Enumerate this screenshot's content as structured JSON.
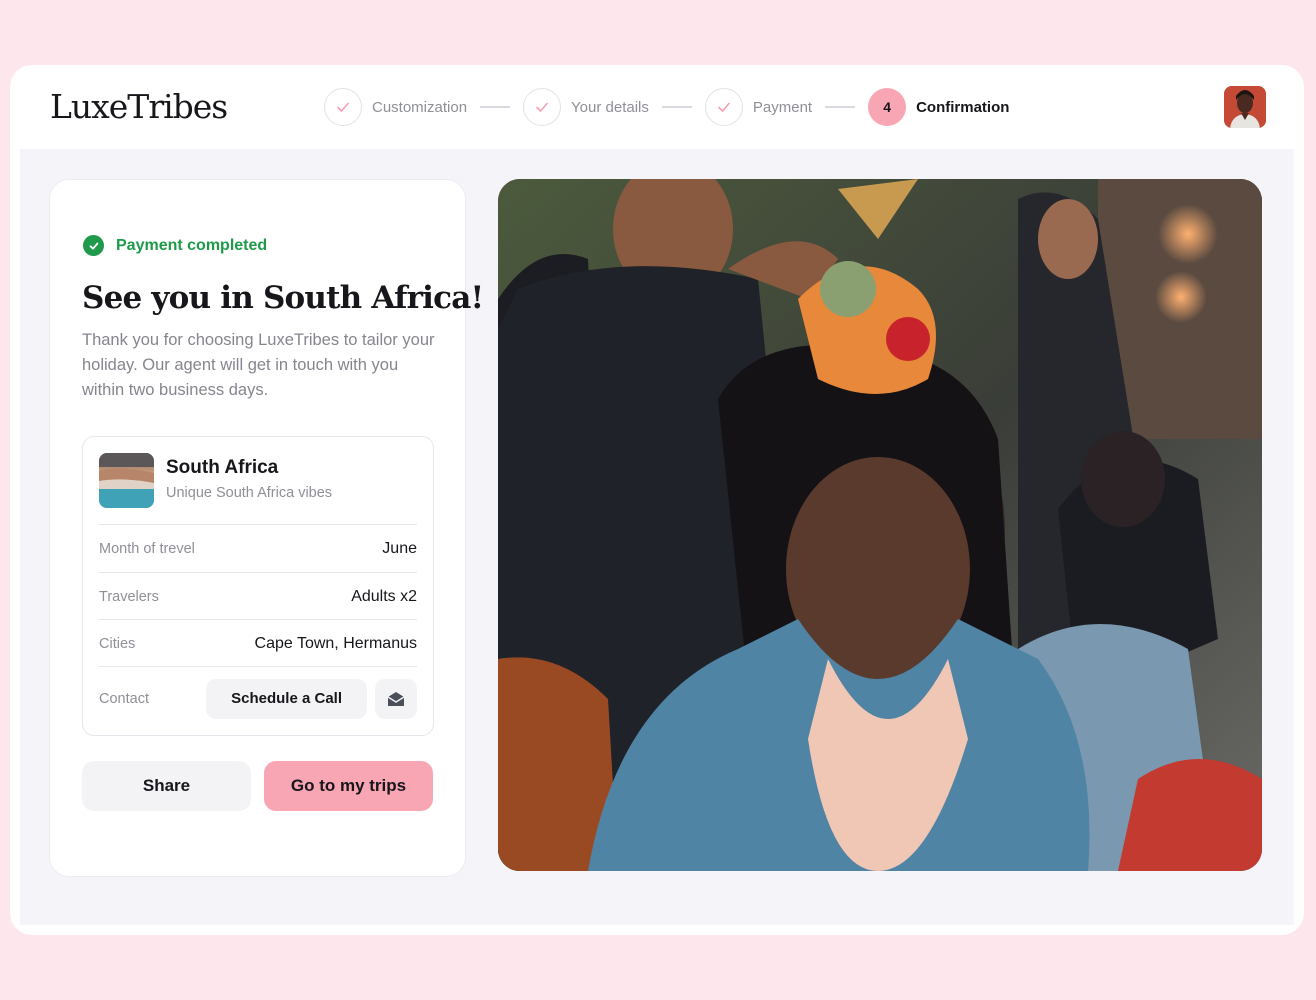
{
  "brand": {
    "name": "LuxeTribes"
  },
  "stepper": {
    "steps": [
      {
        "label": "Customization",
        "state": "done"
      },
      {
        "label": "Your details",
        "state": "done"
      },
      {
        "label": "Payment",
        "state": "done"
      },
      {
        "label": "Confirmation",
        "state": "active",
        "number": "4"
      }
    ]
  },
  "user": {
    "avatar_icon": "user-avatar"
  },
  "confirmation": {
    "status": "Payment completed",
    "headline": "See you in South Africa!",
    "description": "Thank you for choosing LuxeTribes to tailor your holiday. Our agent will get in touch with you within two business days."
  },
  "trip": {
    "title": "South Africa",
    "subtitle": "Unique South Africa vibes",
    "rows": [
      {
        "label": "Month of trevel",
        "value": "June"
      },
      {
        "label": "Travelers",
        "value": "Adults x2"
      },
      {
        "label": "Cities",
        "value": "Cape Town, Hermanus"
      }
    ],
    "contact": {
      "label": "Contact",
      "call_label": "Schedule a Call",
      "mail_icon": "envelope-icon"
    }
  },
  "actions": {
    "share_label": "Share",
    "trips_label": "Go to my trips"
  },
  "colors": {
    "accent": "#f8a6b4",
    "success": "#1f9a4a",
    "page_bg": "#fde7ec",
    "stage_bg": "#f5f5f9"
  }
}
